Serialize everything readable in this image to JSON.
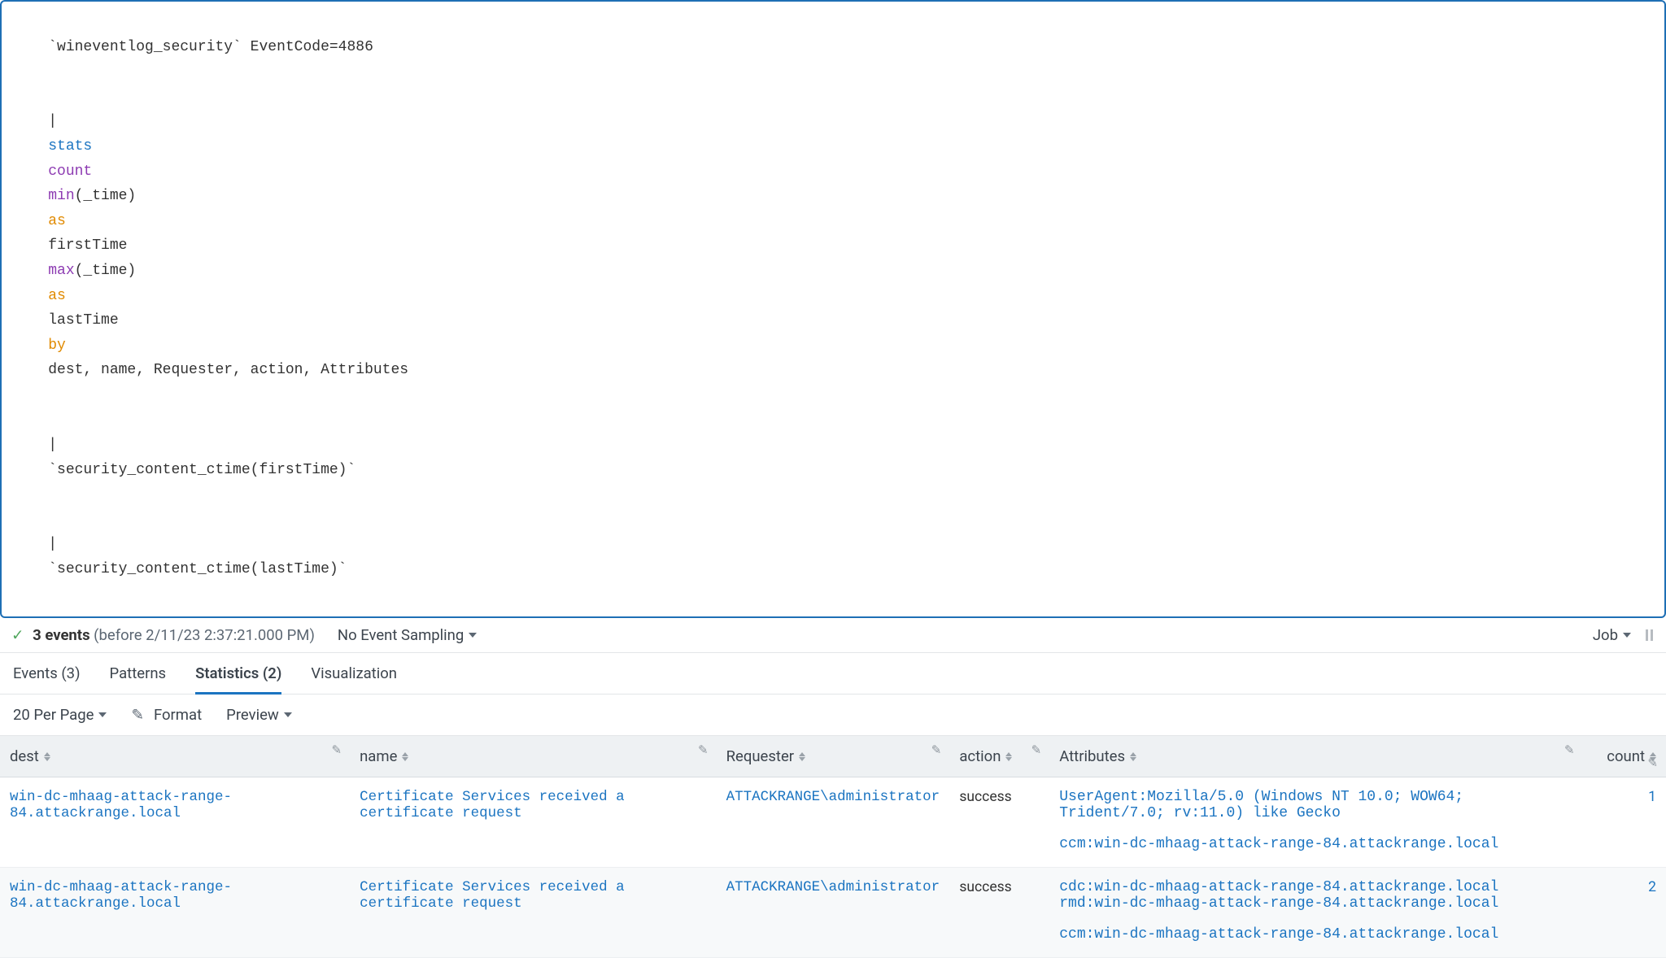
{
  "query": {
    "line1_macro": "`wineventlog_security` EventCode=4886",
    "pipe": "|",
    "stats_cmd": "stats",
    "count_fn": "count",
    "min_fn": "min",
    "min_arg": "(_time)",
    "as_kw": "as",
    "first_alias": "firstTime",
    "max_fn": "max",
    "max_arg": "(_time)",
    "last_alias": "lastTime",
    "by_kw": "by",
    "by_fields": "dest, name, Requester, action, Attributes",
    "line3_macro": "`security_content_ctime(firstTime)`",
    "line4_macro": "`security_content_ctime(lastTime)`"
  },
  "status": {
    "events_bold": "3 events",
    "events_detail": "(before 2/11/23 2:37:21.000 PM)",
    "sampling_label": "No Event Sampling",
    "job_label": "Job"
  },
  "tabs": {
    "events": "Events (3)",
    "patterns": "Patterns",
    "statistics": "Statistics (2)",
    "visualization": "Visualization"
  },
  "table_controls": {
    "per_page": "20 Per Page",
    "format": "Format",
    "preview": "Preview"
  },
  "columns": {
    "dest": "dest",
    "name": "name",
    "requester": "Requester",
    "action": "action",
    "attributes": "Attributes",
    "count": "count"
  },
  "rows": [
    {
      "dest": "win-dc-mhaag-attack-range-84.attackrange.local",
      "name": "Certificate Services received a certificate request",
      "requester": "ATTACKRANGE\\administrator",
      "action": "success",
      "attributes": [
        "UserAgent:Mozilla/5.0 (Windows NT 10.0; WOW64; Trident/7.0; rv:11.0) like Gecko",
        "",
        "ccm:win-dc-mhaag-attack-range-84.attackrange.local"
      ],
      "count": "1"
    },
    {
      "dest": "win-dc-mhaag-attack-range-84.attackrange.local",
      "name": "Certificate Services received a certificate request",
      "requester": "ATTACKRANGE\\administrator",
      "action": "success",
      "attributes": [
        "cdc:win-dc-mhaag-attack-range-84.attackrange.local",
        "rmd:win-dc-mhaag-attack-range-84.attackrange.local",
        "",
        "ccm:win-dc-mhaag-attack-range-84.attackrange.local"
      ],
      "count": "2"
    }
  ]
}
